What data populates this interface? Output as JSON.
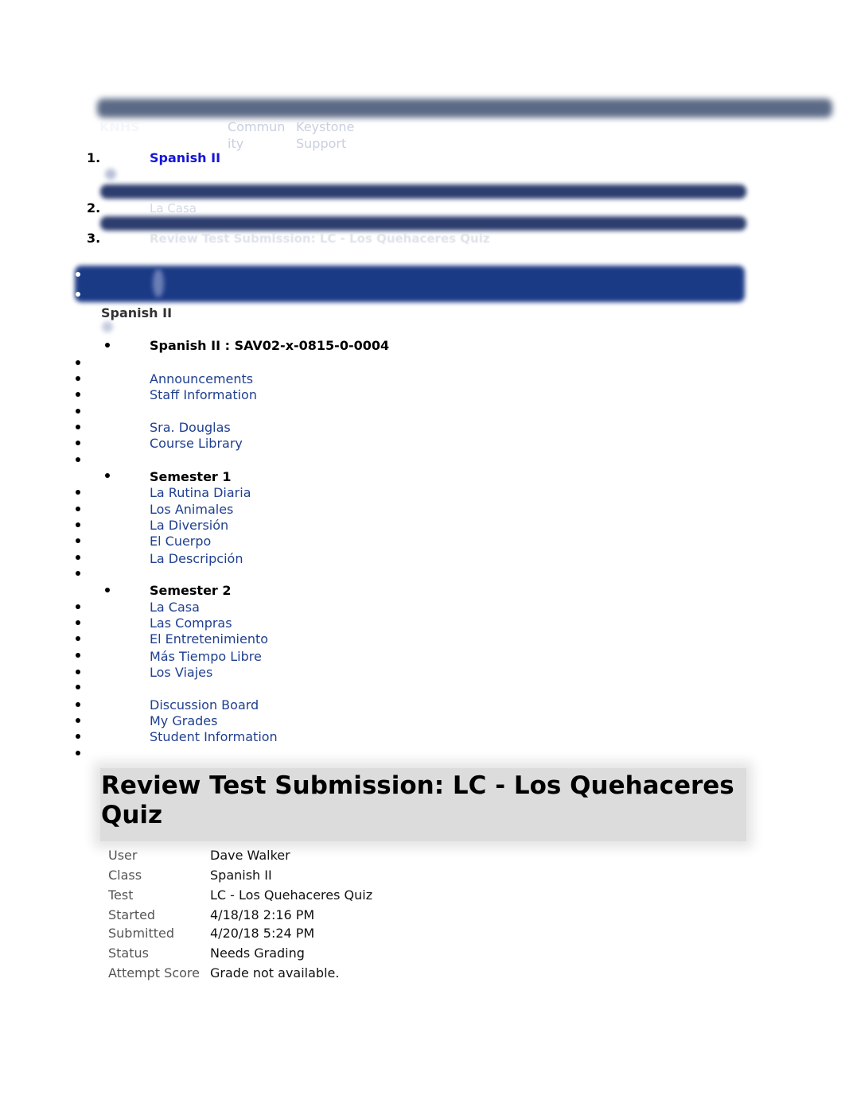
{
  "top_nav": {
    "brand": "KNHS",
    "links": [
      "Commun\nity",
      "Keystone\nSupport"
    ],
    "link_lines": [
      [
        "Commun",
        "ity"
      ],
      [
        "Keystone",
        "Support"
      ]
    ]
  },
  "breadcrumbs": [
    {
      "number": "1.",
      "label": "Spanish II"
    },
    {
      "number": "2.",
      "label": "La Casa"
    },
    {
      "number": "3.",
      "label": "Review Test Submission: LC - Los Quehaceres Quiz"
    }
  ],
  "course_menu": {
    "course_title": "Spanish II",
    "course_code_header": "Spanish II : SAV02-x-0815-0-0004",
    "top_links": [
      "Announcements",
      "Staff Information",
      "Sra. Douglas",
      "Course Library"
    ],
    "semester1": {
      "heading": "Semester 1",
      "items": [
        "La Rutina Diaria",
        "Los Animales",
        "La Diversión",
        "El Cuerpo",
        "La Descripción"
      ]
    },
    "semester2": {
      "heading": "Semester 2",
      "items": [
        "La Casa",
        "Las Compras",
        "El Entretenimiento",
        "Más Tiempo Libre",
        "Los Viajes"
      ]
    },
    "bottom_links": [
      "Discussion Board",
      "My Grades",
      "Student Information"
    ]
  },
  "submission": {
    "title": "Review Test Submission: LC - Los Quehaceres Quiz",
    "details": [
      {
        "label": "User",
        "value": "Dave Walker"
      },
      {
        "label": "Class",
        "value": "Spanish II"
      },
      {
        "label": "Test",
        "value": "LC - Los Quehaceres Quiz"
      },
      {
        "label": "Started",
        "value": "4/18/18 2:16 PM"
      },
      {
        "label": "Submitted",
        "value": "4/20/18 5:24 PM"
      },
      {
        "label": "Status",
        "value": "Needs Grading"
      },
      {
        "label": "Attempt Score",
        "value": "Grade not available."
      }
    ]
  },
  "colors": {
    "link": "#1f3f8f",
    "breadcrumb_link": "#1414d8",
    "course_bar": "#1b3a86",
    "top_bar": "#5b6a86"
  }
}
